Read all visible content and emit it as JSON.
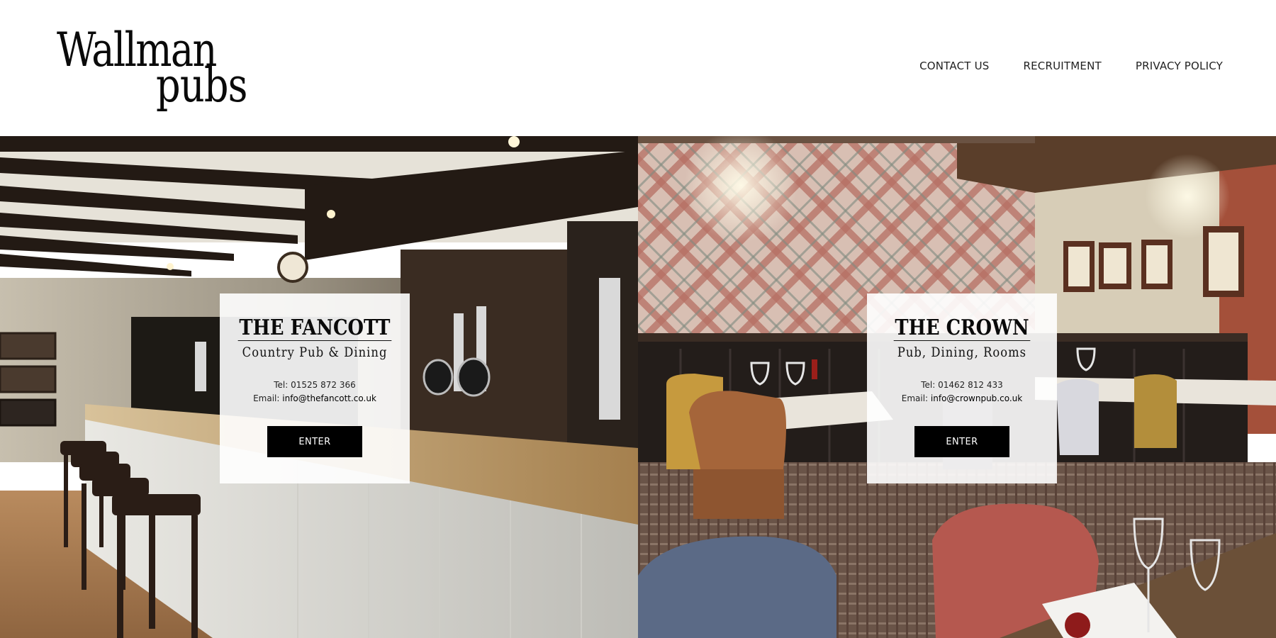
{
  "header": {
    "logo_line1": "Wallman",
    "logo_line2": "pubs",
    "nav": [
      {
        "label": "CONTACT US"
      },
      {
        "label": "RECRUITMENT"
      },
      {
        "label": "PRIVACY POLICY"
      }
    ]
  },
  "pubs": [
    {
      "name": "THE FANCOTT",
      "tagline": "Country Pub & Dining",
      "tel_text": "Tel: 01525 872 366",
      "email_prefix": "Email: ",
      "email": "info@thefancott.co.uk",
      "button_label": "ENTER"
    },
    {
      "name": "THE CROWN",
      "tagline": "Pub, Dining, Rooms",
      "tel_text": "Tel: 01462 812 433",
      "email_prefix": "Email: ",
      "email": "info@crownpub.co.uk",
      "button_label": "ENTER"
    }
  ],
  "colors": {
    "card_bg": "#ffffff",
    "button_bg": "#000000",
    "button_text": "#ffffff",
    "text": "#111111"
  }
}
